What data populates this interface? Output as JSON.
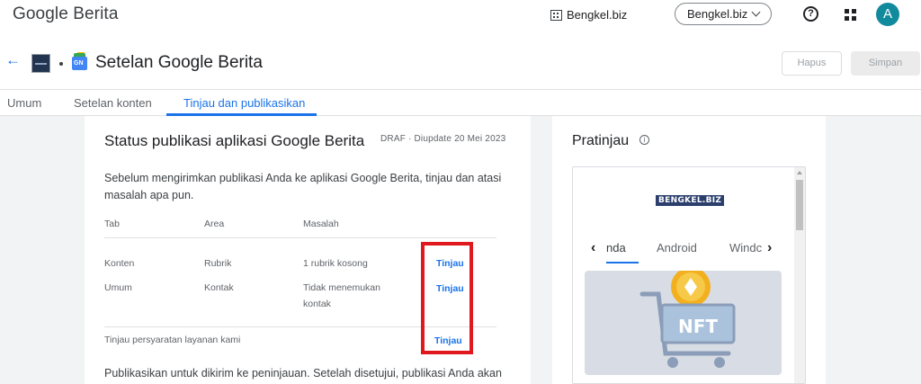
{
  "app": {
    "title": "Google Berita",
    "publication_name": "Bengkel.biz",
    "publication_selector": "Bengkel.biz",
    "avatar_letter": "A",
    "help_symbol": "?"
  },
  "header": {
    "back_symbol": "←",
    "page_title": "Setelan Google Berita",
    "gn_badge": "GN",
    "delete_label": "Hapus",
    "save_label": "Simpan"
  },
  "tabs": [
    {
      "label": "Umum",
      "active": false
    },
    {
      "label": "Setelan konten",
      "active": false
    },
    {
      "label": "Tinjau dan publikasikan",
      "active": true
    }
  ],
  "status": {
    "title": "Status publikasi aplikasi Google Berita",
    "meta": "DRAF · Diupdate 20 Mei 2023",
    "intro": "Sebelum mengirimkan publikasi Anda ke aplikasi Google Berita, tinjau dan atasi masalah apa pun.",
    "columns": [
      "Tab",
      "Area",
      "Masalah"
    ],
    "rows": [
      {
        "tab": "Konten",
        "area": "Rubrik",
        "issue": "1 rubrik kosong",
        "action": "Tinjau"
      },
      {
        "tab": "Umum",
        "area": "Kontak",
        "issue": "Tidak menemukan kontak",
        "action": "Tinjau"
      }
    ],
    "terms": {
      "label": "Tinjau persyaratan layanan kami",
      "action": "Tinjau"
    },
    "outro": "Publikasikan untuk dikirim ke peninjauan. Setelah disetujui, publikasi Anda akan"
  },
  "preview": {
    "title": "Pratinjau",
    "info_symbol": "i",
    "brand_logo": "BENGKEL.BIZ",
    "nav_prev": "‹",
    "nav_next": "›",
    "tabs": [
      {
        "label": "nda",
        "active": true
      },
      {
        "label": "Android",
        "active": false
      },
      {
        "label": "Windc",
        "active": false
      }
    ],
    "hero_text": "NFT"
  },
  "colors": {
    "accent": "#1a73e8",
    "highlight_box": "#e0191f",
    "avatar": "#128a9e"
  }
}
